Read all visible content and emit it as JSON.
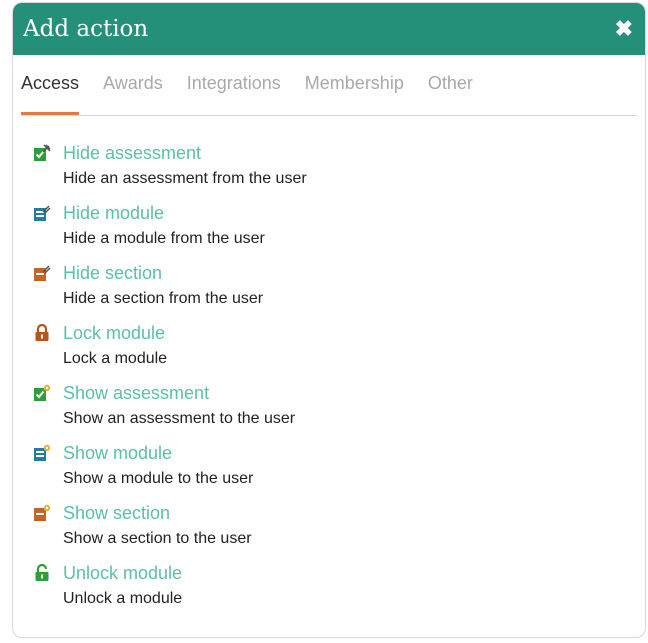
{
  "dialog": {
    "title": "Add action",
    "close_label": "✖"
  },
  "tabs": [
    {
      "label": "Access",
      "active": true
    },
    {
      "label": "Awards"
    },
    {
      "label": "Integrations"
    },
    {
      "label": "Membership"
    },
    {
      "label": "Other"
    }
  ],
  "actions": [
    {
      "title": "Hide assessment",
      "desc": "Hide an assessment from the user",
      "icon": "hide-assessment-icon"
    },
    {
      "title": "Hide module",
      "desc": "Hide a module from the user",
      "icon": "hide-module-icon"
    },
    {
      "title": "Hide section",
      "desc": "Hide a section from the user",
      "icon": "hide-section-icon"
    },
    {
      "title": "Lock module",
      "desc": "Lock a module",
      "icon": "lock-icon"
    },
    {
      "title": "Show assessment",
      "desc": "Show an assessment to the user",
      "icon": "show-assessment-icon"
    },
    {
      "title": "Show module",
      "desc": "Show a module to the user",
      "icon": "show-module-icon"
    },
    {
      "title": "Show section",
      "desc": "Show a section to the user",
      "icon": "show-section-icon"
    },
    {
      "title": "Unlock module",
      "desc": "Unlock a module",
      "icon": "unlock-icon"
    }
  ],
  "colors": {
    "header": "#24907a",
    "link": "#5cbfa8",
    "tab_underline": "#e07b45"
  }
}
